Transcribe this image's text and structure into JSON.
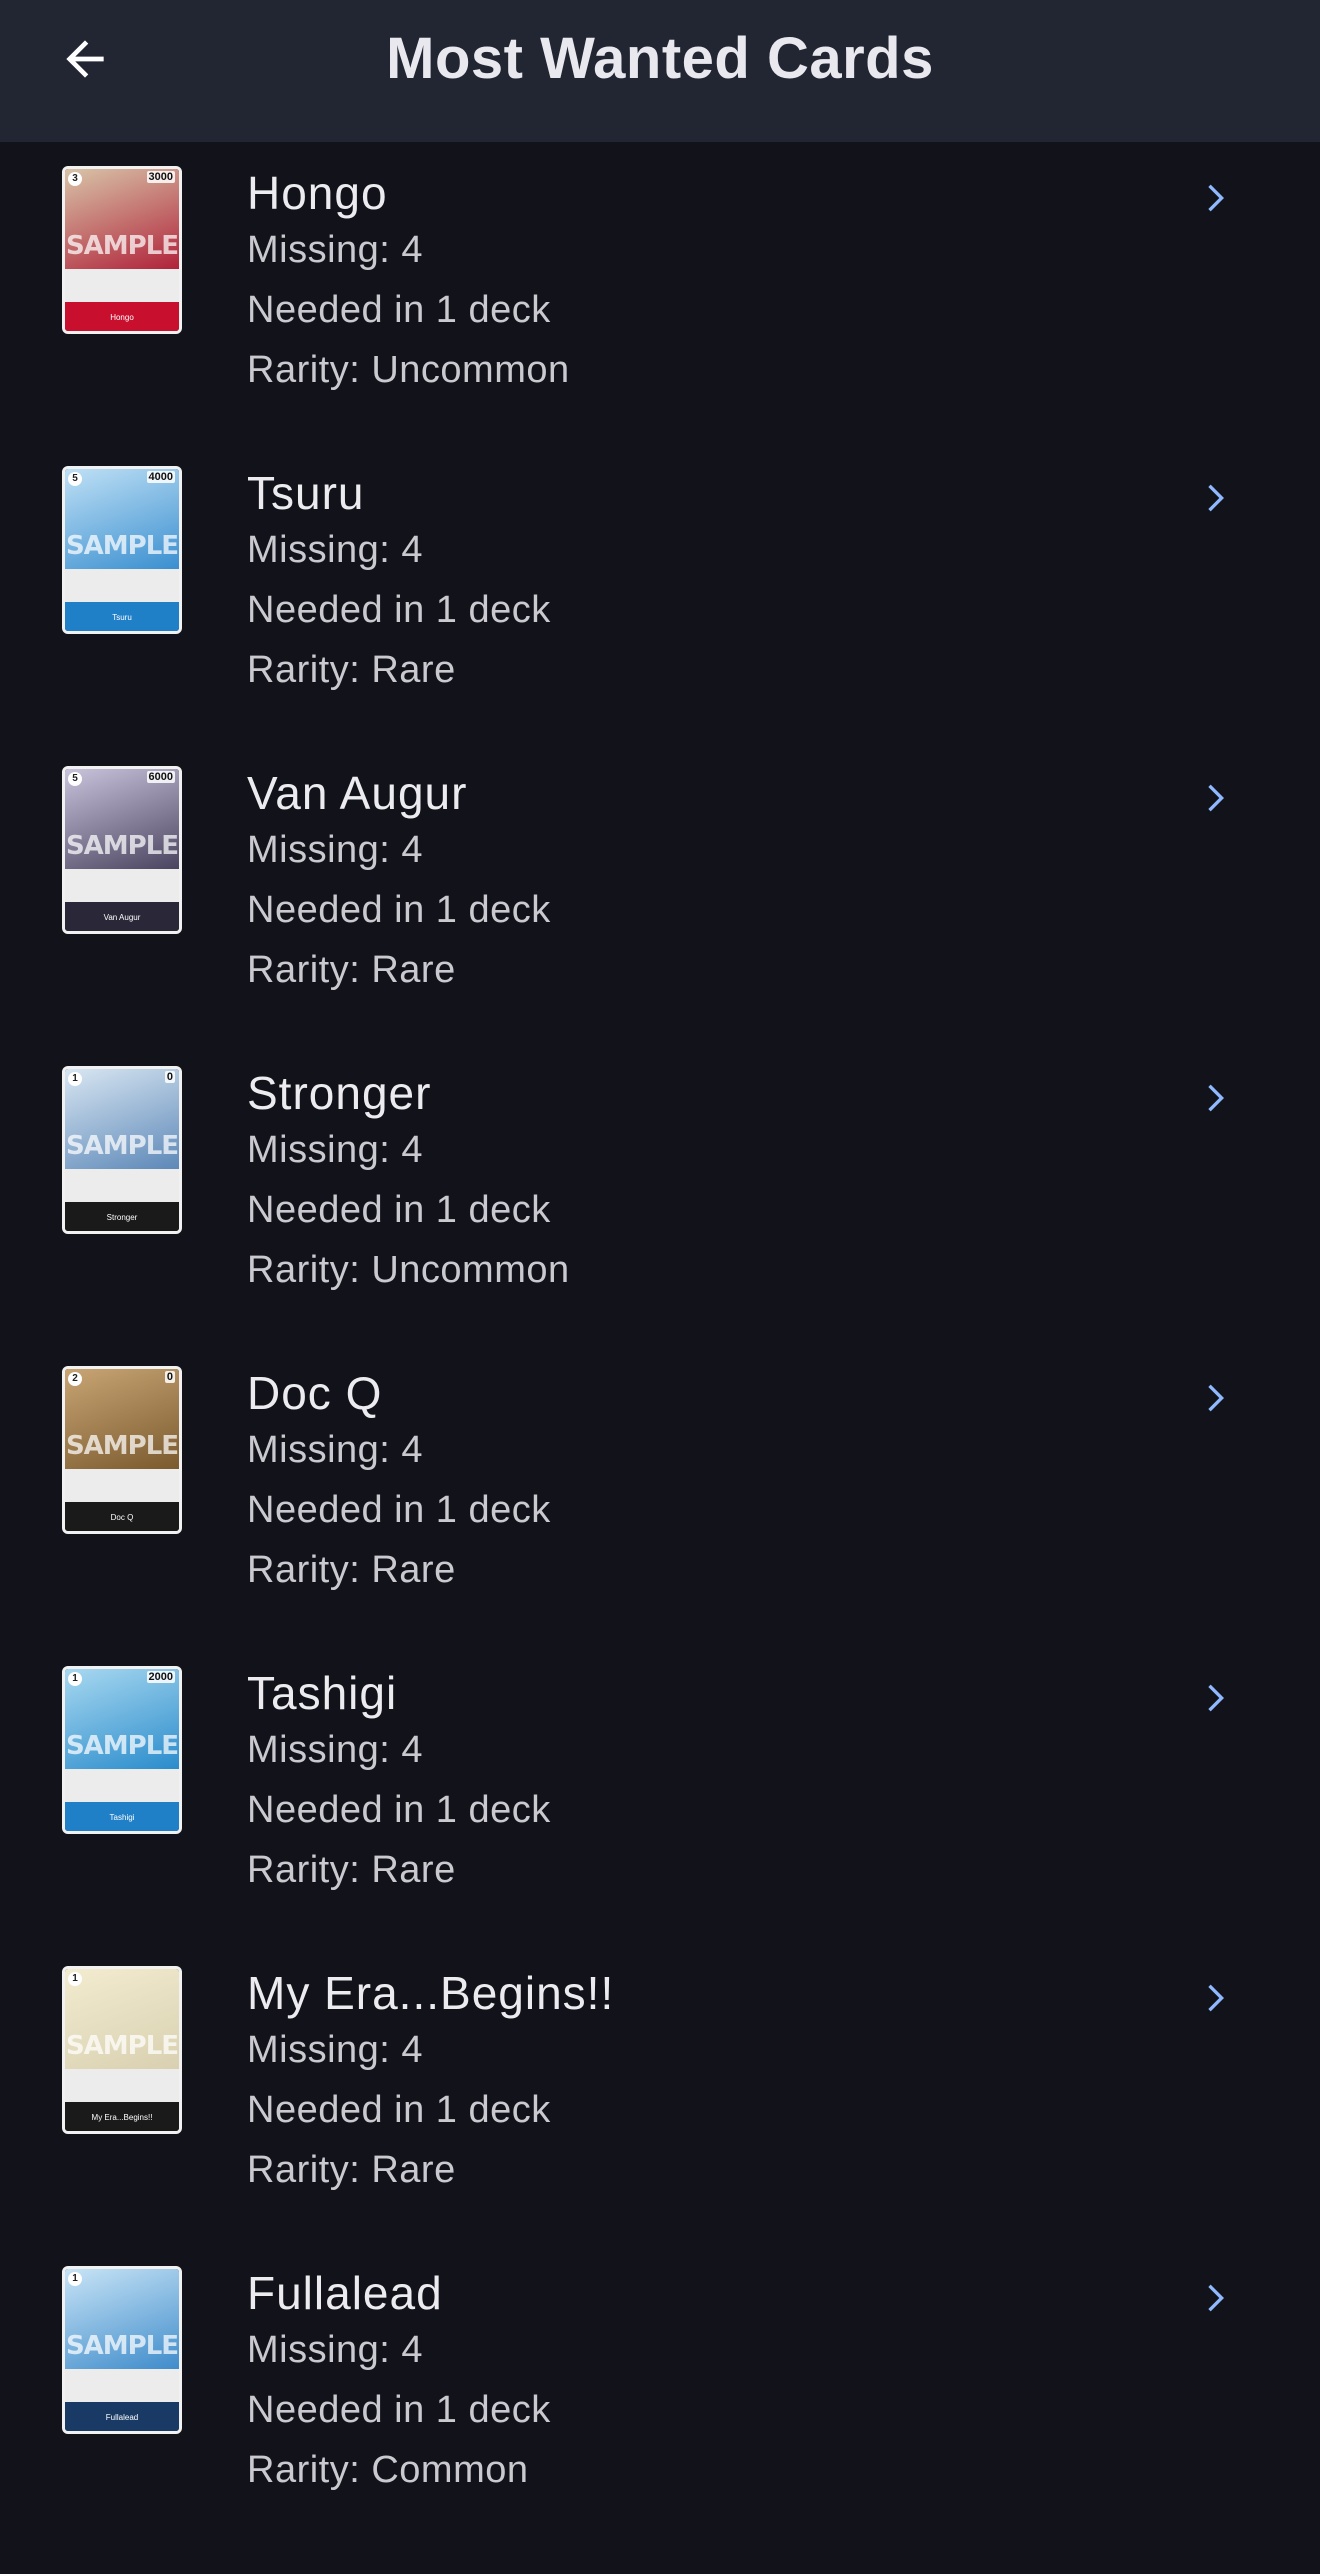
{
  "header": {
    "title": "Most Wanted Cards",
    "back_icon": "arrow-left-icon"
  },
  "accent_color": "#8fb8ff",
  "cards": [
    {
      "name": "Hongo",
      "missing": "Missing: 4",
      "needed": "Needed in 1 deck",
      "rarity": "Rarity: Uncommon",
      "cost": "3",
      "power": "3000",
      "colors": [
        "#b0233a",
        "#d8c4a8",
        "#c8102e"
      ]
    },
    {
      "name": "Tsuru",
      "missing": "Missing: 4",
      "needed": "Needed in 1 deck",
      "rarity": "Rarity: Rare",
      "cost": "5",
      "power": "4000",
      "colors": [
        "#3a8fd0",
        "#bfe0f5",
        "#1f7fc7"
      ]
    },
    {
      "name": "Van Augur",
      "missing": "Missing: 4",
      "needed": "Needed in 1 deck",
      "rarity": "Rarity: Rare",
      "cost": "5",
      "power": "6000",
      "colors": [
        "#4a4460",
        "#c9c3dc",
        "#2a2838"
      ]
    },
    {
      "name": "Stronger",
      "missing": "Missing: 4",
      "needed": "Needed in 1 deck",
      "rarity": "Rarity: Uncommon",
      "cost": "1",
      "power": "0",
      "colors": [
        "#5d88b8",
        "#d8e6f2",
        "#1a1a1a"
      ]
    },
    {
      "name": "Doc Q",
      "missing": "Missing: 4",
      "needed": "Needed in 1 deck",
      "rarity": "Rarity: Rare",
      "cost": "2",
      "power": "0",
      "colors": [
        "#7a5a2e",
        "#c9a574",
        "#1a1a1a"
      ]
    },
    {
      "name": "Tashigi",
      "missing": "Missing: 4",
      "needed": "Needed in 1 deck",
      "rarity": "Rarity: Rare",
      "cost": "1",
      "power": "2000",
      "colors": [
        "#2a8ccc",
        "#a8d8f0",
        "#1f7fc7"
      ]
    },
    {
      "name": "My Era...Begins!!",
      "missing": "Missing: 4",
      "needed": "Needed in 1 deck",
      "rarity": "Rarity: Rare",
      "cost": "1",
      "power": "",
      "colors": [
        "#d8d0b0",
        "#f3ecd0",
        "#1a1a1a"
      ]
    },
    {
      "name": "Fullalead",
      "missing": "Missing: 4",
      "needed": "Needed in 1 deck",
      "rarity": "Rarity: Common",
      "cost": "1",
      "power": "",
      "colors": [
        "#3f8ccb",
        "#c8e4f6",
        "#1a3a66"
      ]
    }
  ]
}
